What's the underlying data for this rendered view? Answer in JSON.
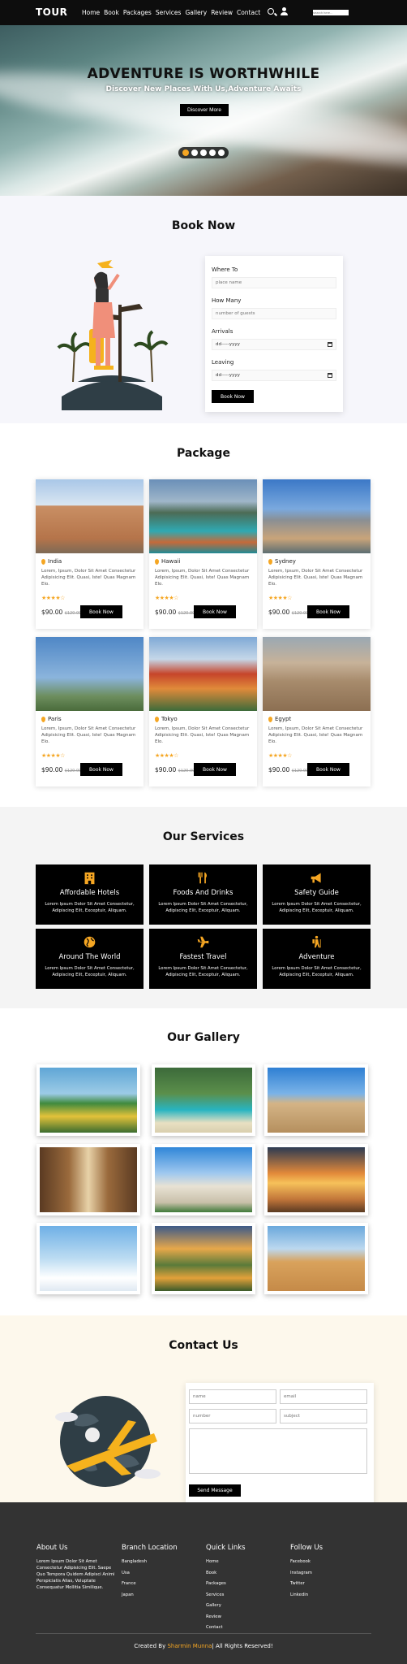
{
  "nav": {
    "logo": "TOUR",
    "links": [
      "Home",
      "Book",
      "Packages",
      "Services",
      "Gallery",
      "Review",
      "Contact"
    ],
    "search_placeholder": "search here..."
  },
  "hero": {
    "title": "ADVENTURE IS WORTHWHILE",
    "subtitle": "Discover New Places With Us,Adventure Awaits",
    "button": "Discover More",
    "slides": 5,
    "active_slide": 1
  },
  "book": {
    "title": "Book Now",
    "where_label": "Where To",
    "where_placeholder": "place name",
    "how_many_label": "How Many",
    "how_many_placeholder": "number of guests",
    "arrivals_label": "Arrivals",
    "arrivals_value": "dd-----yyyy",
    "leaving_label": "Leaving",
    "leaving_value": "dd-----yyyy",
    "button": "Book Now"
  },
  "package": {
    "title": "Package",
    "cards": [
      {
        "place": "India",
        "desc": "Lorem, Ipsum, Dolor Sit Amet Consectetur Adipisicing Elit. Quasi, Iste! Quas Magnam Elo.",
        "rating": 4.5,
        "price": "$90.00",
        "old_price": "$120.00",
        "button": "Book Now"
      },
      {
        "place": "Hawaii",
        "desc": "Lorem, Ipsum, Dolor Sit Amet Consectetur Adipisicing Elit. Quasi, Iste! Quas Magnam Elo.",
        "rating": 4,
        "price": "$90.00",
        "old_price": "$120.00",
        "button": "Book Now"
      },
      {
        "place": "Sydney",
        "desc": "Lorem, Ipsum, Dolor Sit Amet Consectetur Adipisicing Elit. Quasi, Iste! Quas Magnam Elo.",
        "rating": 4,
        "price": "$90.00",
        "old_price": "$120.00",
        "button": "Book Now"
      },
      {
        "place": "Paris",
        "desc": "Lorem, Ipsum, Dolor Sit Amet Consectetur Adipisicing Elit. Quasi, Iste! Quas Magnam Elo.",
        "rating": 4,
        "price": "$90.00",
        "old_price": "$120.00",
        "button": "Book Now"
      },
      {
        "place": "Tokyo",
        "desc": "Lorem, Ipsum, Dolor Sit Amet Consectetur Adipisicing Elit. Quasi, Iste! Quas Magnam Elo.",
        "rating": 4,
        "price": "$90.00",
        "old_price": "$120.00",
        "button": "Book Now"
      },
      {
        "place": "Egypt",
        "desc": "Lorem, Ipsum, Dolor Sit Amet Consectetur Adipisicing Elit. Quasi, Iste! Quas Magnam Elo.",
        "rating": 4,
        "price": "$90.00",
        "old_price": "$120.00",
        "button": "Book Now"
      }
    ]
  },
  "services": {
    "title": "Our Services",
    "items": [
      {
        "title": "Affordable Hotels",
        "desc": "Lorem Ipsum Dolor Sit Amet Consectetur, Adipiscing Elit, Exceptuir, Aliquam.",
        "icon": "hotel-icon"
      },
      {
        "title": "Foods And Drinks",
        "desc": "Lorem Ipsum Dolor Sit Amet Consectetur, Adipiscing Elit, Exceptuir, Aliquam.",
        "icon": "utensils-icon"
      },
      {
        "title": "Safety Guide",
        "desc": "Lorem Ipsum Dolor Sit Amet Consectetur, Adipiscing Elit, Exceptuir, Aliquam.",
        "icon": "bullhorn-icon"
      },
      {
        "title": "Around The World",
        "desc": "Lorem Ipsum Dolor Sit Amet Consectetur, Adipiscing Elit, Exceptuir, Aliquam.",
        "icon": "globe-icon"
      },
      {
        "title": "Fastest Travel",
        "desc": "Lorem Ipsum Dolor Sit Amet Consectetur, Adipiscing Elit, Exceptuir, Aliquam.",
        "icon": "plane-icon"
      },
      {
        "title": "Adventure",
        "desc": "Lorem Ipsum Dolor Sit Amet Consectetur, Adipiscing Elit, Exceptuir, Aliquam.",
        "icon": "hiking-icon"
      }
    ]
  },
  "gallery": {
    "title": "Our Gallery"
  },
  "contact": {
    "title": "Contact Us",
    "name_placeholder": "name",
    "email_placeholder": "email",
    "number_placeholder": "number",
    "subject_placeholder": "subject",
    "button": "Send Message"
  },
  "footer": {
    "about_title": "About Us",
    "about_text": "Lorem Ipsum Dolor Sit Amet Consectetur Adipisicing Elit. Saepe Quo Tempora Quidem Adipisci Animi Perspiciatis Alias, Voluptate Consequatur Mollitia Similique.",
    "branch_title": "Branch Location",
    "branches": [
      "Bangladesh",
      "Usa",
      "France",
      "Japan"
    ],
    "quick_title": "Quick Links",
    "quick_links": [
      "Home",
      "Book",
      "Packages",
      "Services",
      "Gallery",
      "Review",
      "Contact"
    ],
    "follow_title": "Follow Us",
    "follow_links": [
      "Facebook",
      "Instagram",
      "Twitter",
      "Linkedin"
    ],
    "credit_prefix": "Created By",
    "credit_name": "Sharmin Munna",
    "credit_suffix": "| All Rights Reserved!"
  },
  "colors": {
    "accent": "#f5a623",
    "dark": "#000000",
    "footer_bg": "#333333"
  }
}
